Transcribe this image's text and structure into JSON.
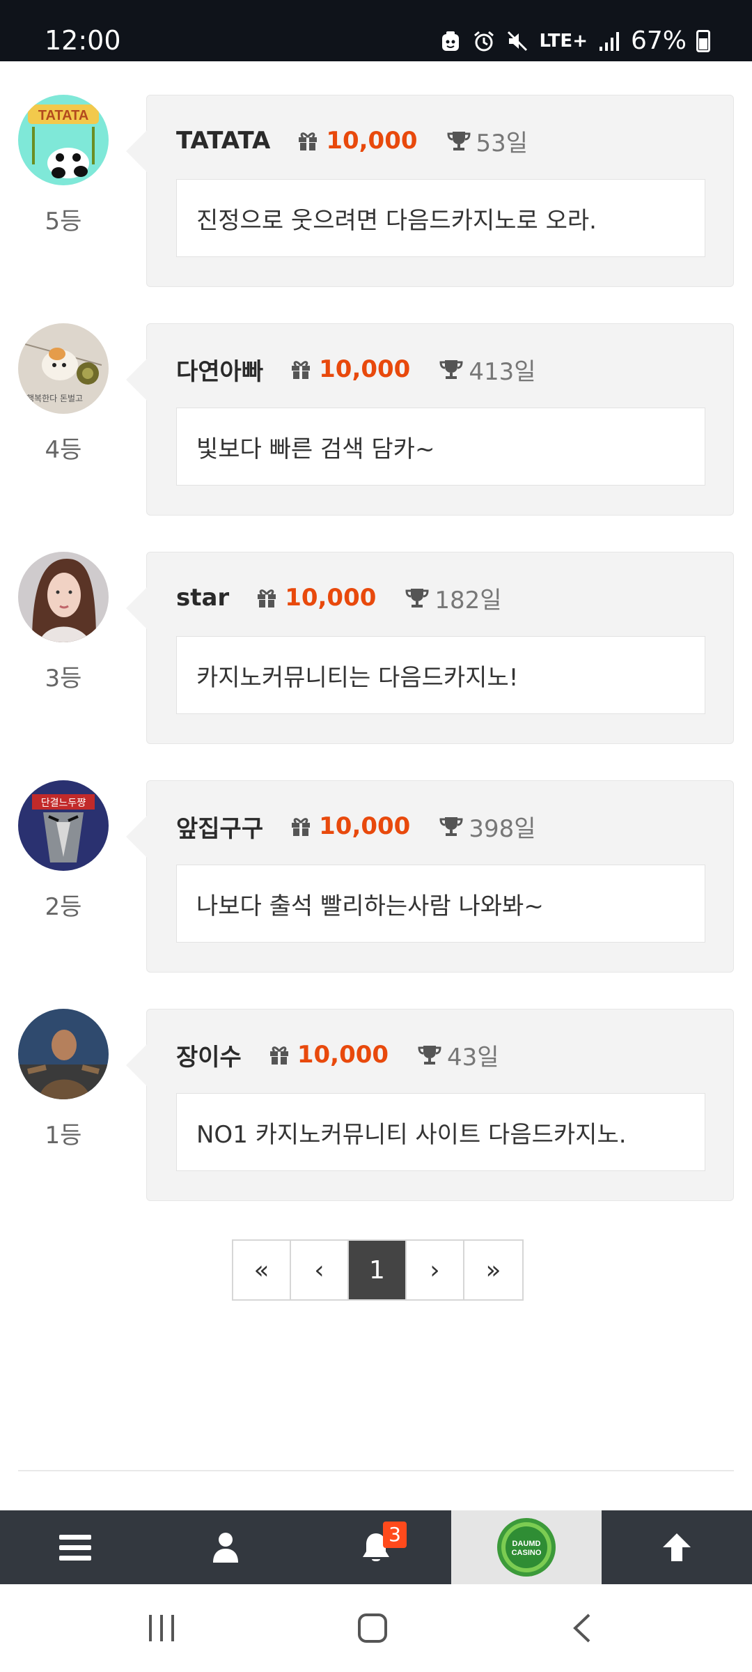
{
  "status_bar": {
    "time": "12:00",
    "icons": [
      "cat-notification-icon",
      "alarm-icon",
      "mute-icon",
      "lte-icon",
      "signal-icon",
      "battery-icon"
    ],
    "network": "LTE+",
    "battery": "67%"
  },
  "entries": [
    {
      "rank": "5등",
      "nickname": "TATATA",
      "points": "10,000",
      "days": "53일",
      "message": "진정으로 웃으려면 다음드카지노로 오라."
    },
    {
      "rank": "4등",
      "nickname": "다연아빠",
      "points": "10,000",
      "days": "413일",
      "message": "빛보다 빠른 검색 담카~"
    },
    {
      "rank": "3등",
      "nickname": "star",
      "points": "10,000",
      "days": "182일",
      "message": "카지노커뮤니티는 다음드카지노!"
    },
    {
      "rank": "2등",
      "nickname": "앞집구구",
      "points": "10,000",
      "days": "398일",
      "message": "나보다 출석 빨리하는사람 나와봐~"
    },
    {
      "rank": "1등",
      "nickname": "장이수",
      "points": "10,000",
      "days": "43일",
      "message": "NO1 카지노커뮤니티 사이트 다음드카지노."
    }
  ],
  "pagination": {
    "first": "«",
    "prev": "‹",
    "current": "1",
    "next": "›",
    "last": "»"
  },
  "bottom_nav": {
    "notification_count": "3",
    "logo_text": "DAUMD CASINO"
  },
  "colors": {
    "points": "#e8490c",
    "nav_bg": "#33383f",
    "badge": "#ff4a1c"
  }
}
